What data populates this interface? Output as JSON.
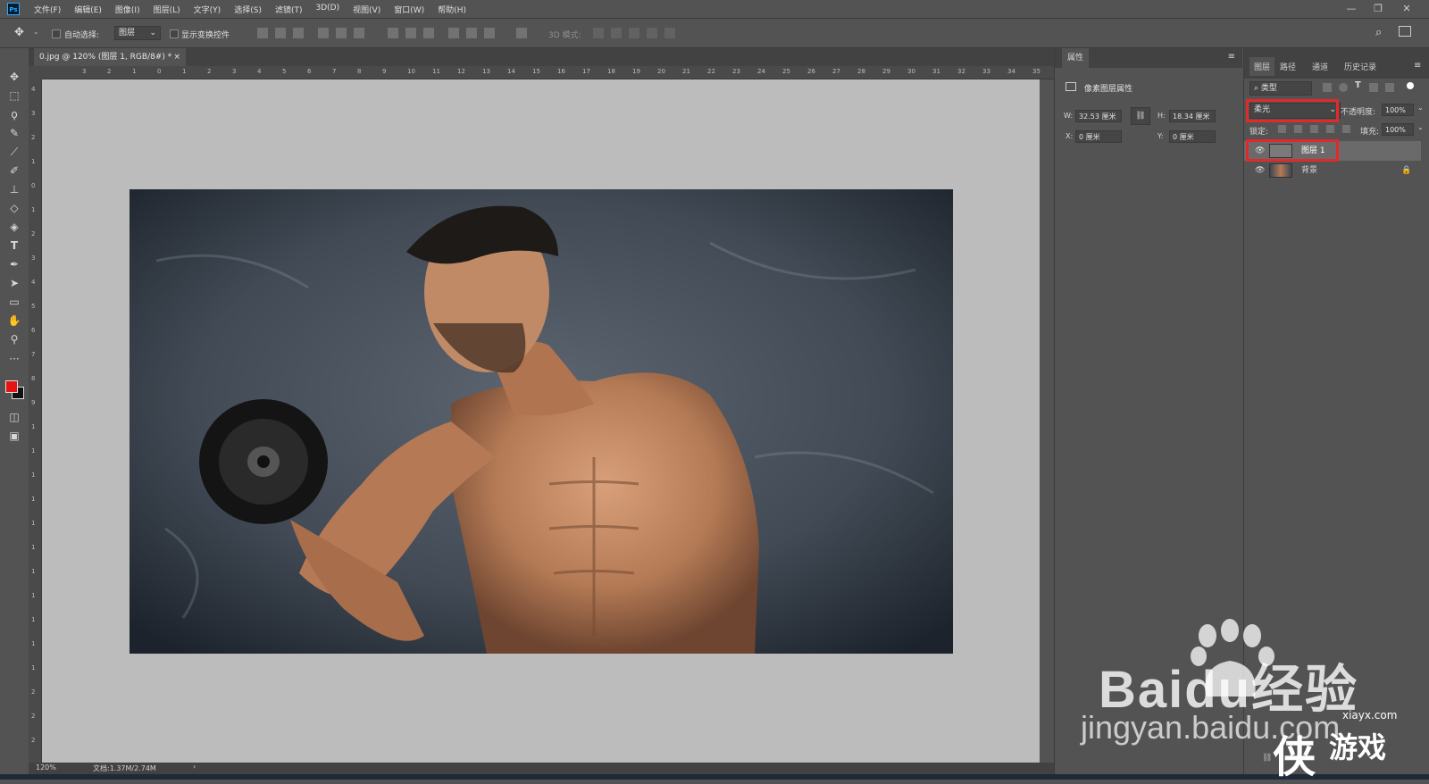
{
  "app": {
    "logo": "Ps"
  },
  "menu": [
    "文件(F)",
    "编辑(E)",
    "图像(I)",
    "图层(L)",
    "文字(Y)",
    "选择(S)",
    "滤镜(T)",
    "3D(D)",
    "视图(V)",
    "窗口(W)",
    "帮助(H)"
  ],
  "window_controls": {
    "minimize": "—",
    "restore": "❐",
    "close": "✕"
  },
  "options": {
    "auto_select_label": "自动选择:",
    "auto_select_value": "图层",
    "transform_label": "显示变换控件",
    "mode_3d_label": "3D 模式:"
  },
  "document": {
    "tab_title": "0.jpg @ 120% (图层 1, RGB/8#) *",
    "close": "×"
  },
  "ruler": {
    "h_ticks": [
      "3",
      "2",
      "1",
      "0",
      "1",
      "2",
      "3",
      "4",
      "5",
      "6",
      "7",
      "8",
      "9",
      "10",
      "11",
      "12",
      "13",
      "14",
      "15",
      "16",
      "17",
      "18",
      "19",
      "20",
      "21",
      "22",
      "23",
      "24",
      "25",
      "26",
      "27",
      "28",
      "29",
      "30",
      "31",
      "32",
      "33",
      "34",
      "35"
    ],
    "v_ticks": [
      "4",
      "3",
      "2",
      "1",
      "0",
      "1",
      "2",
      "3",
      "4",
      "5",
      "6",
      "7",
      "8",
      "9",
      "1",
      "1",
      "1",
      "1",
      "1",
      "1",
      "1",
      "1",
      "1",
      "1",
      "1",
      "2",
      "2",
      "2"
    ]
  },
  "status": {
    "zoom": "120%",
    "doc_info": "文档:1.37M/2.74M",
    "arrow": "›"
  },
  "properties": {
    "tab": "属性",
    "section_title": "像素图层属性",
    "w_label": "W:",
    "w_value": "32.53 厘米",
    "h_label": "H:",
    "h_value": "18.34 厘米",
    "x_label": "X:",
    "x_value": "0 厘米",
    "y_label": "Y:",
    "y_value": "0 厘米"
  },
  "layers_panel": {
    "tabs": [
      "图层",
      "路径",
      "通道",
      "历史记录"
    ],
    "filter_label": "类型",
    "blend_mode": "柔光",
    "opacity_label": "不透明度:",
    "opacity_value": "100%",
    "lock_label": "锁定:",
    "fill_label": "填充:",
    "fill_value": "100%",
    "layers": [
      {
        "name": "图层 1",
        "selected": true
      },
      {
        "name": "背景",
        "locked": true
      }
    ]
  },
  "watermark": {
    "brand": "Baidu经验",
    "url": "jingyan.baidu.com",
    "site": "xiayx.com",
    "game_text": "游戏"
  },
  "colors": {
    "foreground": "#e41414",
    "background": "#111111",
    "highlight": "#e02a2a"
  }
}
